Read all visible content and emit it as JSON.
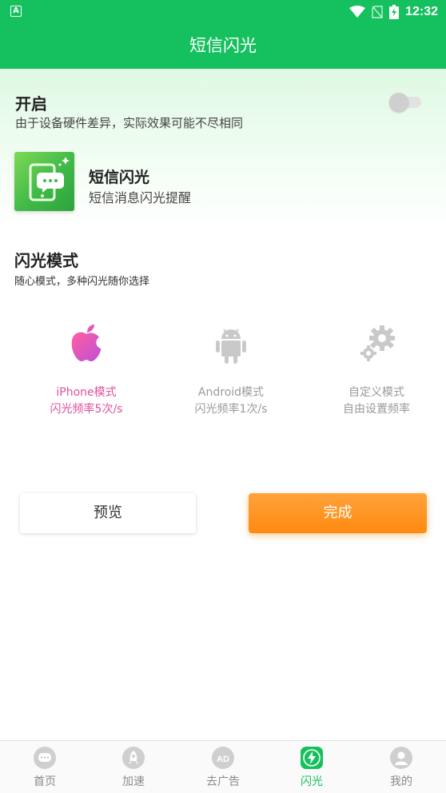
{
  "status_bar": {
    "time": "12:32",
    "left_icon": "A"
  },
  "app_bar": {
    "title": "短信闪光"
  },
  "switch_section": {
    "title": "开启",
    "subtitle": "由于设备硬件差异，实际效果可能不尽相同",
    "enabled": false
  },
  "feature": {
    "title": "短信闪光",
    "subtitle": "短信消息闪光提醒",
    "icon": "sms-phone-icon"
  },
  "mode_section": {
    "title": "闪光模式",
    "subtitle": "随心模式，多种闪光随你选择",
    "options": [
      {
        "name": "iPhone模式",
        "desc": "闪光频率5次/s",
        "icon": "apple-icon",
        "selected": true
      },
      {
        "name": "Android模式",
        "desc": "闪光频率1次/s",
        "icon": "android-icon",
        "selected": false
      },
      {
        "name": "自定义模式",
        "desc": "自由设置频率",
        "icon": "gears-icon",
        "selected": false
      }
    ]
  },
  "buttons": {
    "preview": "预览",
    "done": "完成"
  },
  "bottom_nav": {
    "items": [
      {
        "label": "首页",
        "icon": "chat-icon",
        "active": false
      },
      {
        "label": "加速",
        "icon": "rocket-icon",
        "active": false
      },
      {
        "label": "去广告",
        "icon": "ad-icon",
        "active": false
      },
      {
        "label": "闪光",
        "icon": "bolt-icon",
        "active": true
      },
      {
        "label": "我的",
        "icon": "person-icon",
        "active": false
      }
    ]
  },
  "colors": {
    "primary": "#15c05e",
    "accent_orange": "#ff8a10",
    "iphone_pink": "#e0509d"
  }
}
